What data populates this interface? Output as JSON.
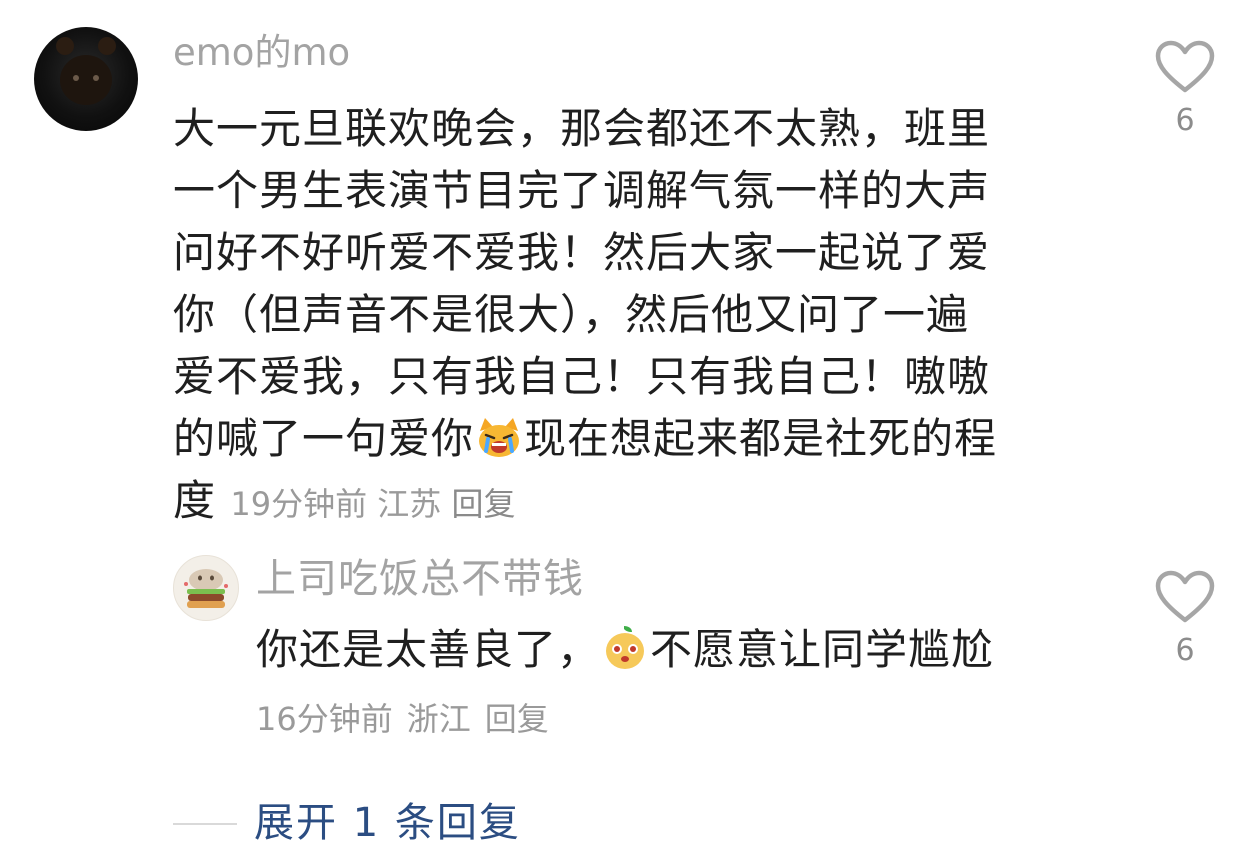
{
  "comment": {
    "username": "emo的mo",
    "text_lines": [
      "大一元旦联欢晚会，那会都还不太熟，班里",
      "一个男生表演节目完了调解气氛一样的大声",
      "问好不好听爱不爱我！然后大家一起说了爱",
      "你（但声音不是很大），然后他又问了一遍",
      "爱不爱我，只有我自己！只有我自己！嗷嗷",
      "的喊了一句爱你"
    ],
    "text_after_emoji": "现在想起来都是社死的程",
    "text_last": "度",
    "time": "19分钟前",
    "location": "江苏",
    "reply_label": "回复",
    "likes": "6",
    "emoji": "crying-cat-emoji"
  },
  "reply": {
    "username": "上司吃饭总不带钱",
    "text_before_emoji": "你还是太善良了，",
    "text_after_emoji": "不愿意让同学尴尬",
    "time": "16分钟前",
    "location": "浙江",
    "reply_label": "回复",
    "likes": "6",
    "emoji": "orange-face-emoji"
  },
  "expand": {
    "label": "展开 1 条回复"
  },
  "colors": {
    "text": "#1f1f1f",
    "muted": "#a3a3a3",
    "link": "#2b4d82"
  }
}
